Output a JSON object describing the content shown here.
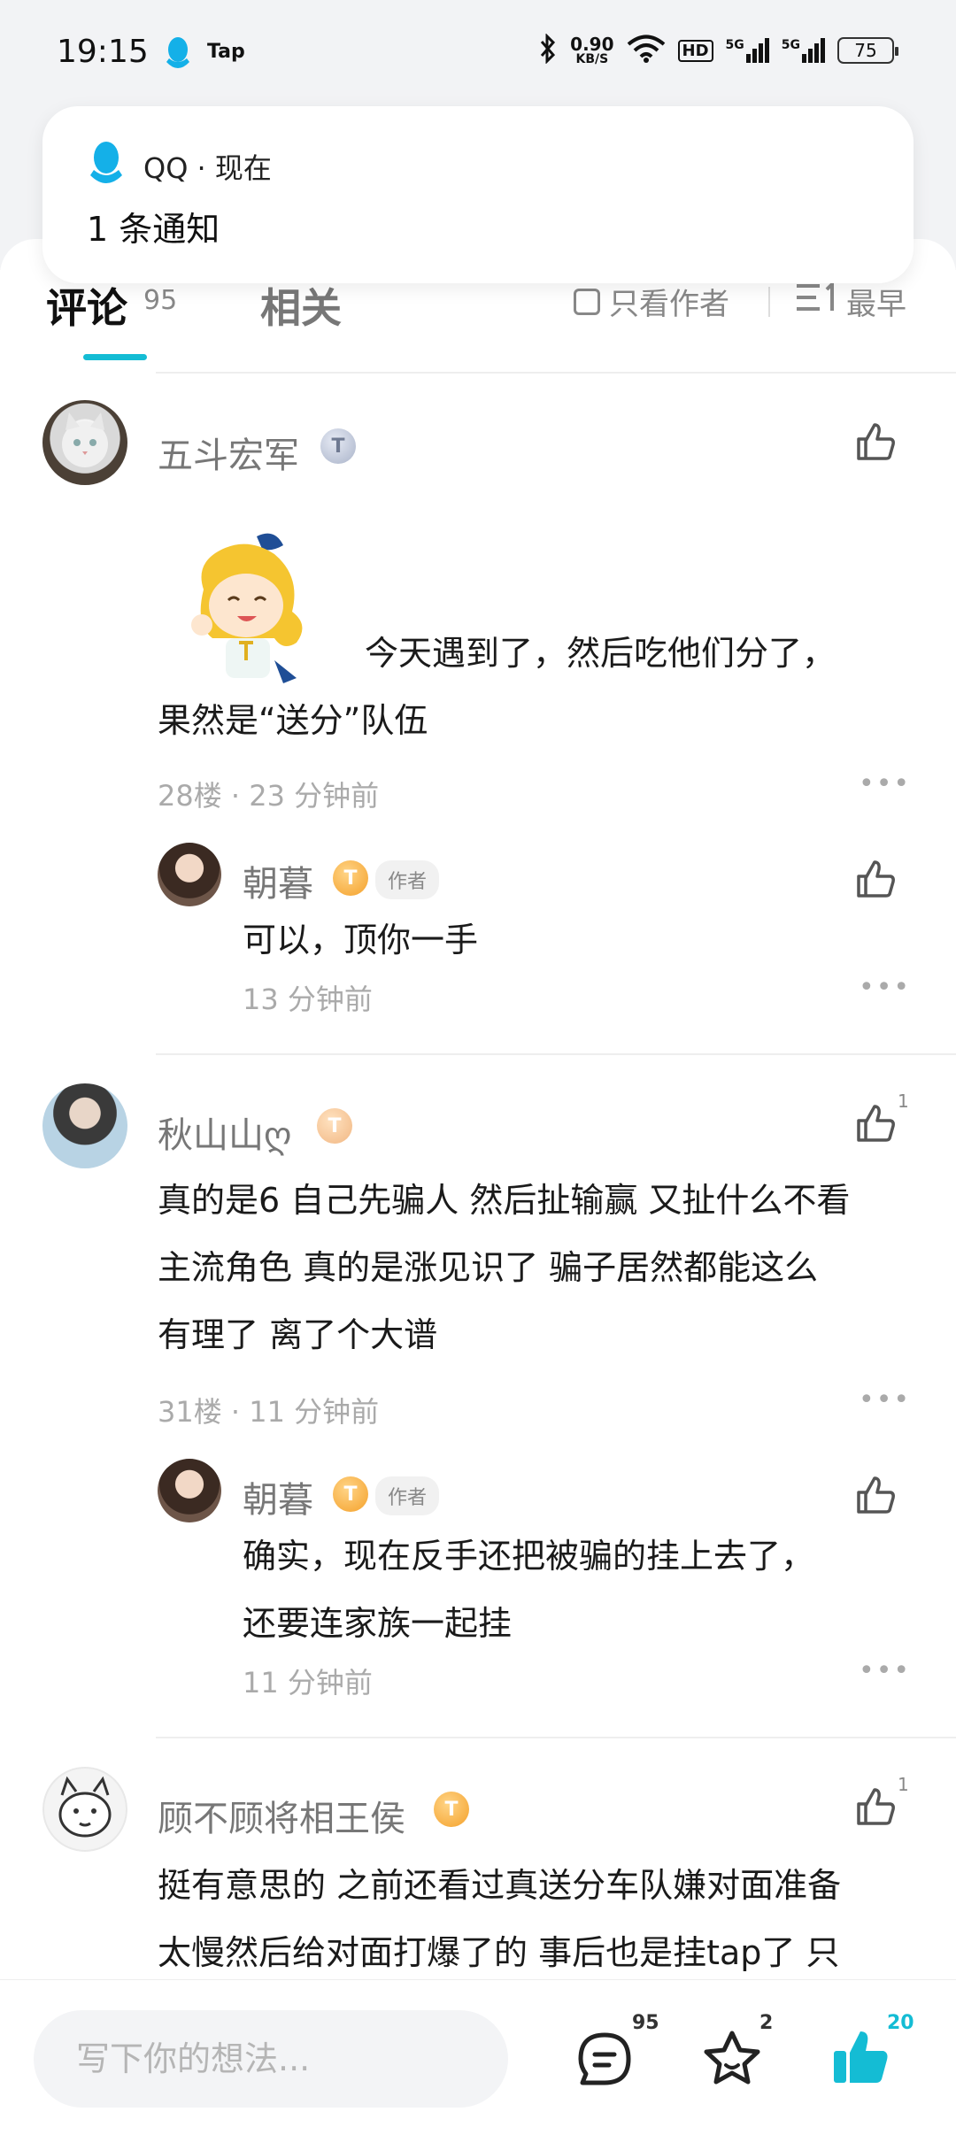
{
  "status_bar": {
    "time": "19:15",
    "tap_label": "Tap",
    "net_speed_value": "0.90",
    "net_speed_unit": "KB/S",
    "hd_label": "HD",
    "signal1_label": "5G",
    "signal2_label": "5G",
    "battery": "75"
  },
  "notification": {
    "app": "QQ · 现在",
    "text": "1 条通知"
  },
  "tabs": {
    "comments_label": "评论",
    "comments_count": "95",
    "related_label": "相关",
    "author_only_label": "只看作者",
    "sort_label": "最早"
  },
  "comments": [
    {
      "username": "五斗宏军",
      "text": "今天遇到了，然后吃他们分了，",
      "text2": "果然是“送分”队伍",
      "floor_time": "28楼 · 23 分钟前",
      "reply": {
        "username": "朝暮",
        "author_tag": "作者",
        "text": "可以，顶你一手",
        "time": "13 分钟前"
      }
    },
    {
      "username": "秋山山ღ",
      "like_count": "1",
      "lines": [
        "真的是6 自己先骗人 然后扯输赢 又扯什么不看",
        "主流角色 真的是涨见识了 骗子居然都能这么",
        "有理了 离了个大谱"
      ],
      "floor_time": "31楼 · 11 分钟前",
      "reply": {
        "username": "朝暮",
        "author_tag": "作者",
        "lines": [
          "确实，现在反手还把被骗的挂上去了，",
          "还要连家族一起挂"
        ],
        "time": "11 分钟前"
      }
    },
    {
      "username": "顾不顾将相王侯",
      "like_count": "1",
      "lines": [
        "挺有意思的 之前还看过真送分车队嫌对面准备",
        "太慢然后给对面打爆了的 事后也是挂tap了 只"
      ]
    }
  ],
  "bottom_bar": {
    "input_placeholder": "写下你的想法...",
    "comments_count": "95",
    "favorites_count": "2",
    "likes_count": "20"
  },
  "colors": {
    "accent": "#14bcd4",
    "badge_orange": "#f4a12b",
    "text_secondary": "#777777"
  }
}
